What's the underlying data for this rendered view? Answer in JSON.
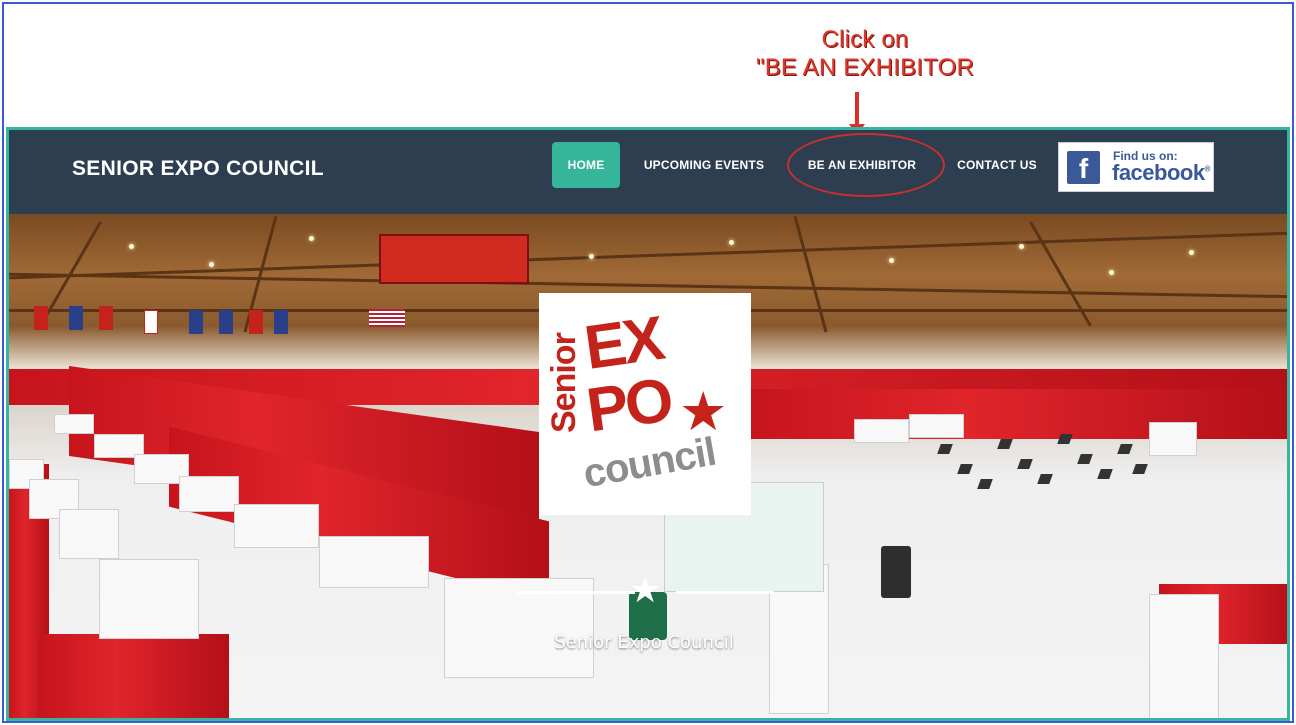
{
  "annotation": {
    "line1": "Click on",
    "line2": "\"BE AN EXHIBITOR"
  },
  "navbar": {
    "brand": "SENIOR EXPO COUNCIL",
    "items": [
      {
        "label": "HOME",
        "active": true
      },
      {
        "label": "UPCOMING EVENTS",
        "active": false
      },
      {
        "label": "BE AN EXHIBITOR",
        "active": false
      },
      {
        "label": "CONTACT US",
        "active": false
      }
    ],
    "facebook": {
      "letter": "f",
      "small_text": "Find us on:",
      "big_text": "facebook"
    }
  },
  "hero": {
    "logo": {
      "senior": "Senior",
      "ex": "EX",
      "po": "PO",
      "council": "council"
    },
    "caption": "Senior Expo Council"
  },
  "colors": {
    "frame_border": "#3b5bd6",
    "site_border": "#37b3a0",
    "navbar_bg": "#2d3e50",
    "active_nav": "#35b59a",
    "annotation": "#e0352b",
    "facebook": "#3b5998"
  }
}
